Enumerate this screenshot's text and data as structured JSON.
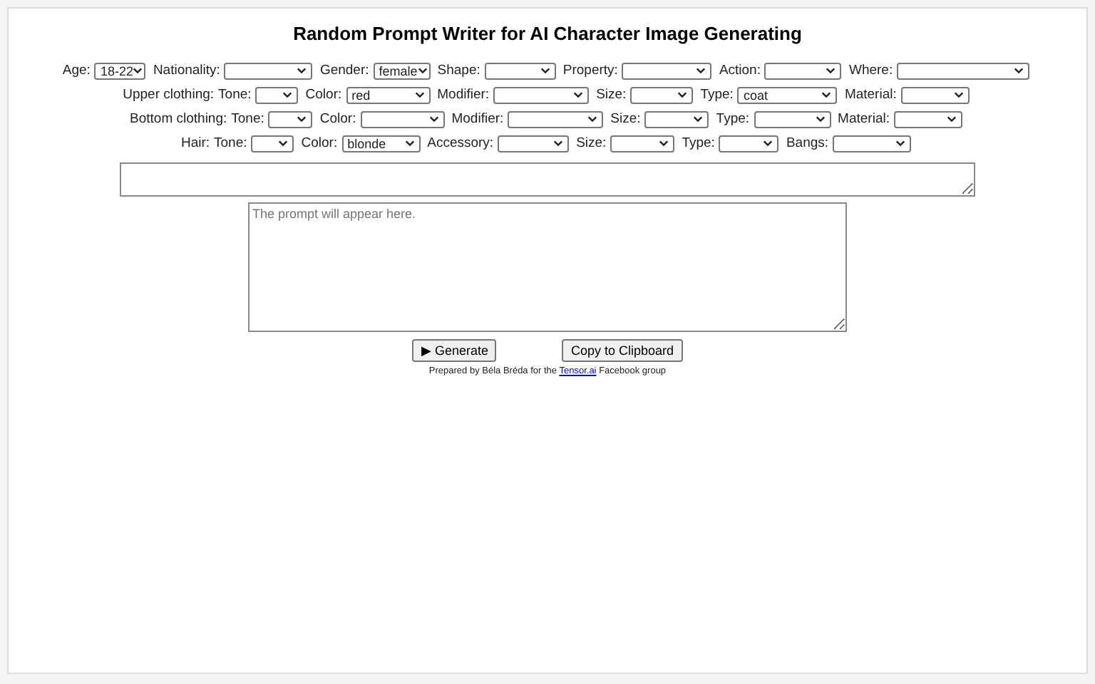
{
  "title": "Random Prompt Writer for AI Character Image Generating",
  "rows": [
    {
      "fields": [
        {
          "label": "Age:",
          "value": "18-22"
        },
        {
          "label": "Nationality:"
        },
        {
          "label": "Gender:",
          "value": "female"
        },
        {
          "label": "Shape:"
        },
        {
          "label": "Property:"
        },
        {
          "label": "Action:"
        },
        {
          "label": "Where:"
        }
      ]
    },
    {
      "group": "Upper clothing:",
      "fields": [
        {
          "label": "Tone:"
        },
        {
          "label": "Color:",
          "value": "red"
        },
        {
          "label": "Modifier:"
        },
        {
          "label": "Size:"
        },
        {
          "label": "Type:",
          "value": "coat"
        },
        {
          "label": "Material:"
        }
      ]
    },
    {
      "group": "Bottom clothing:",
      "fields": [
        {
          "label": "Tone:"
        },
        {
          "label": "Color:"
        },
        {
          "label": "Modifier:"
        },
        {
          "label": "Size:"
        },
        {
          "label": "Type:"
        },
        {
          "label": "Material:"
        }
      ]
    },
    {
      "group": "Hair:",
      "fields": [
        {
          "label": "Tone:"
        },
        {
          "label": "Color:",
          "value": "blonde"
        },
        {
          "label": "Accessory:"
        },
        {
          "label": "Size:"
        },
        {
          "label": "Type:"
        },
        {
          "label": "Bangs:"
        }
      ]
    }
  ],
  "prompt": {
    "placeholder": "The prompt will appear here."
  },
  "buttons": [
    {
      "icon": "▶",
      "label": "Generate"
    },
    {
      "label": "Copy to Clipboard"
    }
  ],
  "credit": "Prepared by Béla Bréda for the",
  "credit_link": "Tensor.ai",
  "credit_end": "Facebook group"
}
